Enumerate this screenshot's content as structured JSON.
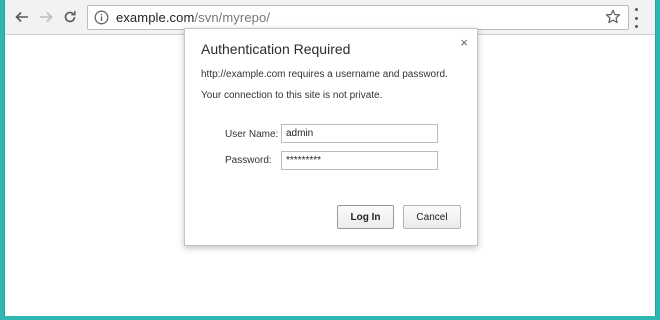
{
  "browser": {
    "url_host": "example.com",
    "url_path": "/svn/myrepo/"
  },
  "dialog": {
    "title": "Authentication Required",
    "close_glyph": "×",
    "message_line1": "http://example.com requires a username and password.",
    "message_line2": "Your connection to this site is not private.",
    "username_label": "User Name:",
    "username_value": "admin",
    "password_label": "Password:",
    "password_value": "*********",
    "login_label": "Log In",
    "cancel_label": "Cancel"
  },
  "icons": {
    "back": "back-arrow-icon",
    "forward": "forward-arrow-icon",
    "reload": "reload-icon",
    "info": "info-icon",
    "star": "star-icon",
    "menu": "kebab-menu-icon"
  },
  "colors": {
    "desktop": "#2fb6b0",
    "toolbar": "#f2f2f2"
  }
}
